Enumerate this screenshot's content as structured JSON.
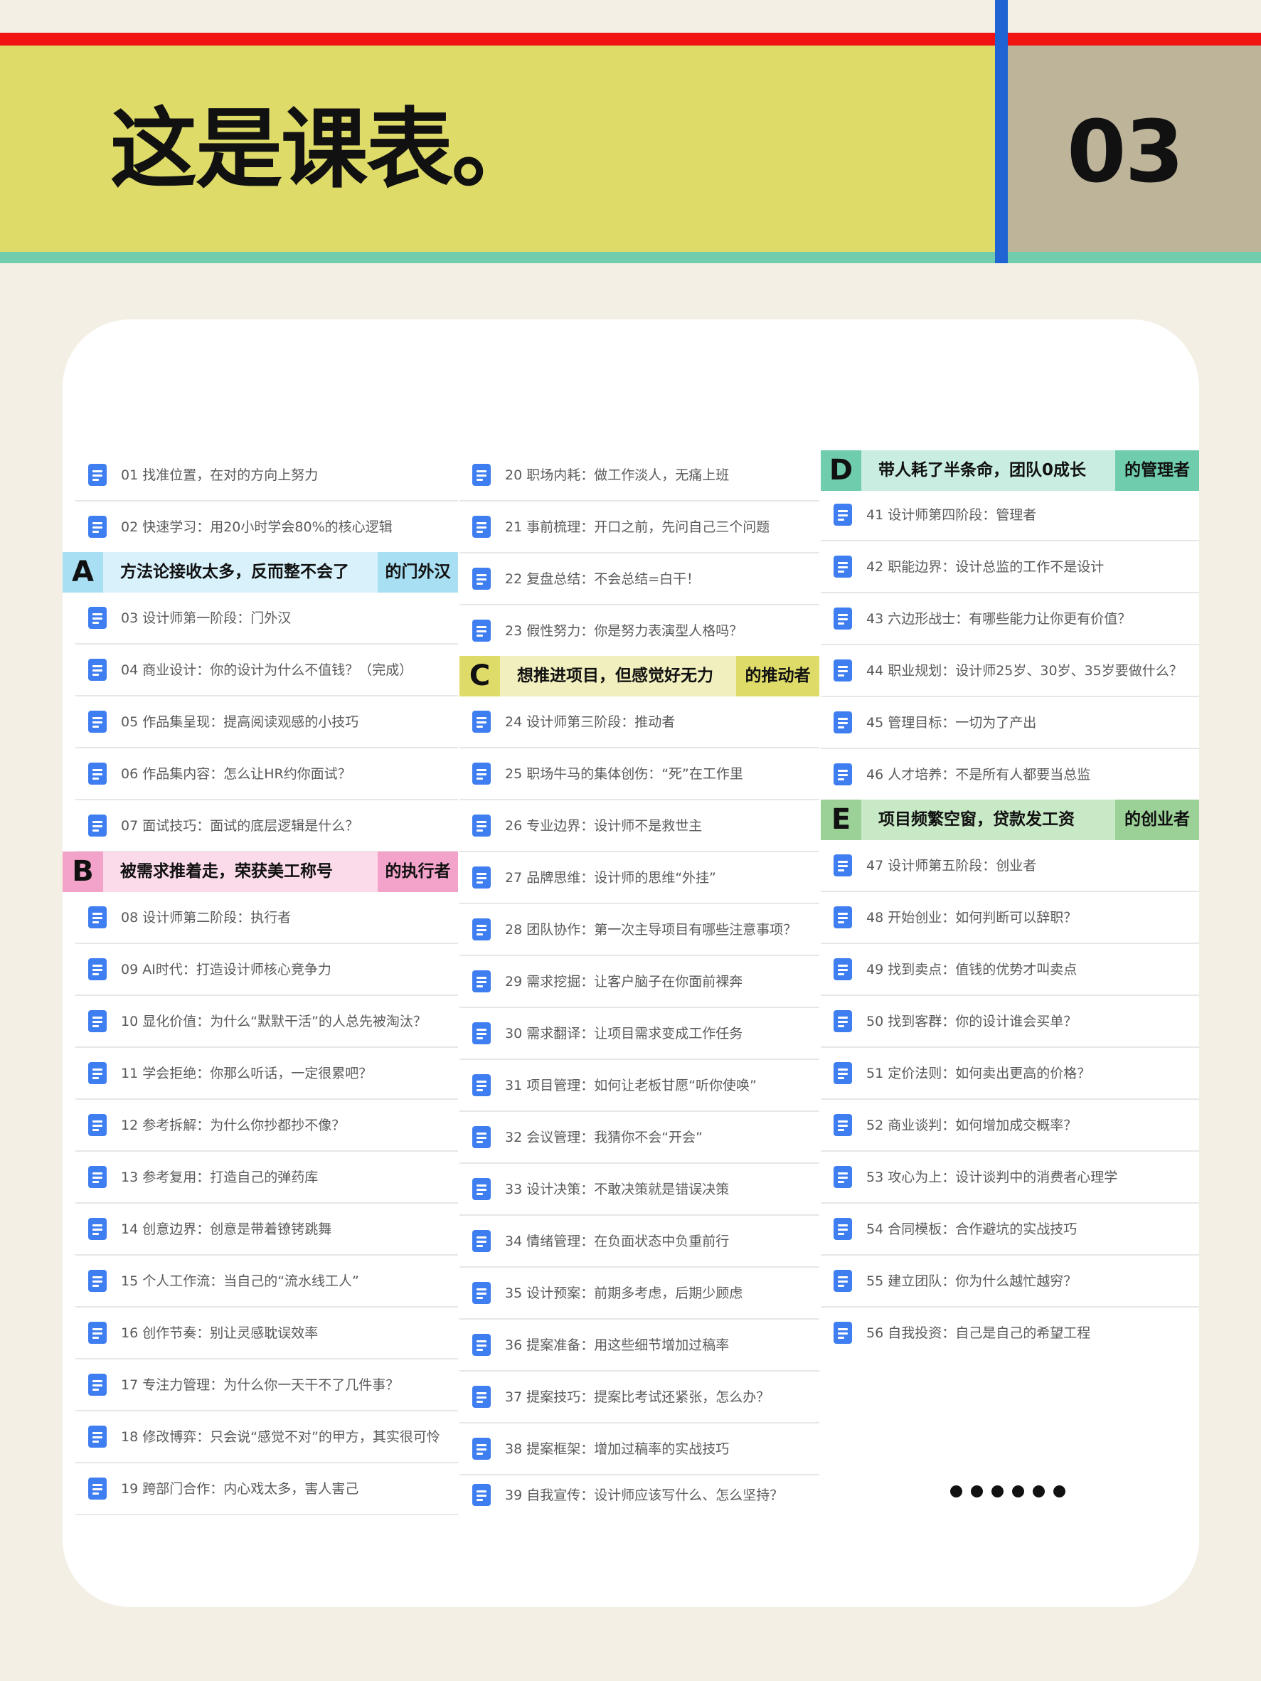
{
  "header": {
    "title": "这是课表。",
    "number": "03"
  },
  "colors": {
    "red_stripe": "#f11212",
    "yellow": "#dedb69",
    "tan": "#bdb49a",
    "teal": "#6fcdae",
    "blue_divider": "#1f64d2",
    "doc_icon": "#3f7ef0"
  },
  "sections": {
    "A": {
      "letter": "A",
      "title": "方法论接收太多，反而整不会了",
      "tag": "的门外汉"
    },
    "B": {
      "letter": "B",
      "title": "被需求推着走，荣获美工称号",
      "tag": "的执行者"
    },
    "C": {
      "letter": "C",
      "title": "想推进项目，但感觉好无力",
      "tag": "的推动者"
    },
    "D": {
      "letter": "D",
      "title": "带人耗了半条命，团队0成长",
      "tag": "的管理者"
    },
    "E": {
      "letter": "E",
      "title": "项目频繁空窗，贷款发工资",
      "tag": "的创业者"
    }
  },
  "lessons": [
    "01 找准位置，在对的方向上努力",
    "02 快速学习：用20小时学会80%的核心逻辑",
    "03 设计师第一阶段：门外汉",
    "04 商业设计：你的设计为什么不值钱？（完成）",
    "05 作品集呈现：提高阅读观感的小技巧",
    "06 作品集内容：怎么让HR约你面试？",
    "07 面试技巧：面试的底层逻辑是什么？",
    "08 设计师第二阶段：执行者",
    "09 AI时代：打造设计师核心竞争力",
    "10 显化价值：为什么“默默干活”的人总先被淘汰？",
    "11 学会拒绝：你那么听话，一定很累吧？",
    "12 参考拆解：为什么你抄都抄不像？",
    "13 参考复用：打造自己的弹药库",
    "14 创意边界：创意是带着镣铐跳舞",
    "15 个人工作流：当自己的“流水线工人”",
    "16 创作节奏：别让灵感耽误效率",
    "17 专注力管理：为什么你一天干不了几件事？",
    "18 修改博弈：只会说“感觉不对”的甲方，其实很可怜",
    "19 跨部门合作：内心戏太多，害人害己",
    "20 职场内耗：做工作淡人，无痛上班",
    "21 事前梳理：开口之前，先问自己三个问题",
    "22 复盘总结：不会总结=白干！",
    "23 假性努力：你是努力表演型人格吗？",
    "24 设计师第三阶段：推动者",
    "25 职场牛马的集体创伤：“死”在工作里",
    "26 专业边界：设计师不是救世主",
    "27 品牌思维：设计师的思维“外挂”",
    "28 团队协作：第一次主导项目有哪些注意事项？",
    "29 需求挖掘：让客户脑子在你面前裸奔",
    "30 需求翻译：让项目需求变成工作任务",
    "31 项目管理：如何让老板甘愿“听你使唤”",
    "32 会议管理：我猜你不会“开会”",
    "33 设计决策：不敢决策就是错误决策",
    "34 情绪管理：在负面状态中负重前行",
    "35 设计预案：前期多考虑，后期少顾虑",
    "36 提案准备：用这些细节增加过稿率",
    "37 提案技巧：提案比考试还紧张，怎么办？",
    "38 提案框架：增加过稿率的实战技巧",
    "39 自我宣传：设计师应该写什么、怎么坚持？",
    "41 设计师第四阶段：管理者",
    "42 职能边界：设计总监的工作不是设计",
    "43 六边形战士：有哪些能力让你更有价值？",
    "44 职业规划：设计师25岁、30岁、35岁要做什么？",
    "45 管理目标：一切为了产出",
    "46 人才培养：不是所有人都要当总监",
    "47 设计师第五阶段：创业者",
    "48 开始创业：如何判断可以辞职？",
    "49 找到卖点：值钱的优势才叫卖点",
    "50 找到客群：你的设计谁会买单？",
    "51 定价法则：如何卖出更高的价格？",
    "52 商业谈判：如何增加成交概率？",
    "53 攻心为上：设计谈判中的消费者心理学",
    "54 合同模板：合作避坑的实战技巧",
    "55 建立团队：你为什么越忙越穷？",
    "56 自我投资：自己是自己的希望工程"
  ]
}
